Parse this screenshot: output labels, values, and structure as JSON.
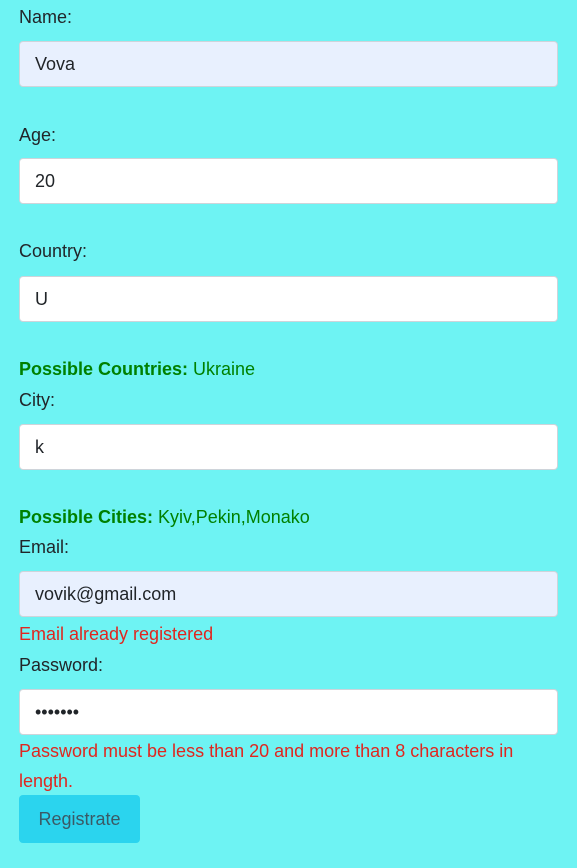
{
  "form": {
    "name": {
      "label": "Name:",
      "value": "Vova"
    },
    "age": {
      "label": "Age:",
      "value": "20"
    },
    "country": {
      "label": "Country:",
      "value": "U"
    },
    "possible_countries": {
      "prefix": "Possible Countries:",
      "value": " Ukraine"
    },
    "city": {
      "label": "City:",
      "value": "k"
    },
    "possible_cities": {
      "prefix": "Possible Cities:",
      "value": " Kyiv,Pekin,Monako"
    },
    "email": {
      "label": "Email:",
      "value": "vovik@gmail.com",
      "error": "Email already registered"
    },
    "password": {
      "label": "Password:",
      "value": "1234567",
      "error": "Password must be less than 20 and more than 8 characters in length."
    },
    "submit_label": "Registrate"
  },
  "colors": {
    "background": "#6ef3f3",
    "hint": "#008000",
    "error": "#e0261f",
    "button": "#2bd4ee"
  }
}
